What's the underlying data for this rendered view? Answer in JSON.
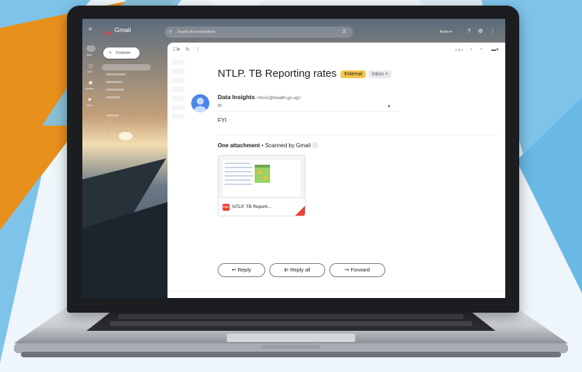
{
  "gmail": {
    "app_name": "Gmail",
    "search_placeholder": "Search all conversations",
    "status": "Active",
    "compose_label": "Compose",
    "sidebar_labels": {
      "mail": "Mail",
      "chat": "Chat",
      "spaces": "Spaces",
      "meet": "Meet"
    },
    "pagination": "1 of 1"
  },
  "email": {
    "subject": "NTLP. TB Reporting rates",
    "tag_external": "External",
    "tag_inbox": "Inbox",
    "sender_name": "Data Insights",
    "sender_email": "<hmis@health.go.ug>",
    "to_label": "to",
    "body": "FYI",
    "attachment_heading": "One attachment",
    "attachment_scanned": " • Scanned by Gmail",
    "attachment_name": "NTLP. TB Reporti...",
    "reply_label": "Reply",
    "reply_all_label": "Reply all",
    "forward_label": "Forward"
  },
  "colors": {
    "brand_orange": "#e8901c",
    "sky_blue": "#7ec3ea",
    "external_tag": "#f6c44a",
    "pdf_red": "#ea4335"
  }
}
